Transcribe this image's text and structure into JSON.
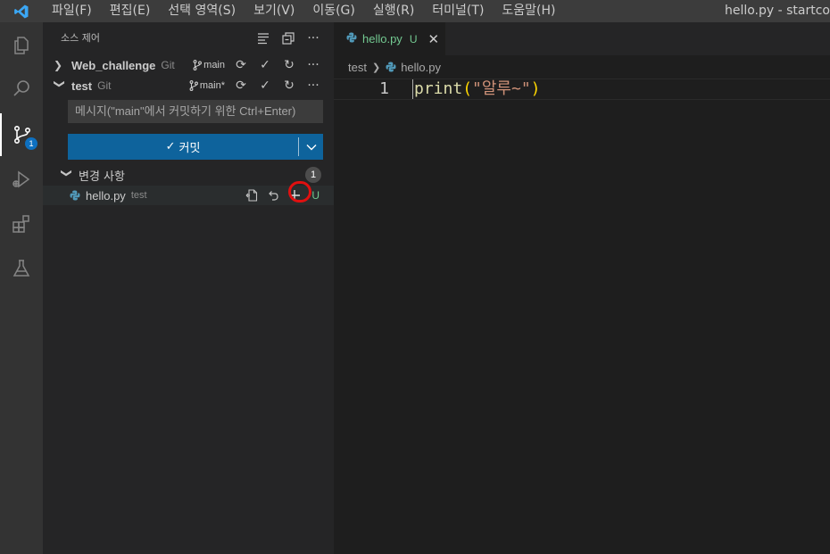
{
  "titlebar": {
    "menu": [
      "파일(F)",
      "편집(E)",
      "선택 영역(S)",
      "보기(V)",
      "이동(G)",
      "실행(R)",
      "터미널(T)",
      "도움말(H)"
    ],
    "window_title": "hello.py - startco"
  },
  "activity": {
    "items": [
      "explorer-icon",
      "search-icon",
      "source-control-icon",
      "run-debug-icon",
      "extensions-icon",
      "testing-icon"
    ],
    "source_control_badge": "1"
  },
  "sidebar": {
    "title": "소스 제어",
    "repos": [
      {
        "name": "Web_challenge",
        "provider": "Git",
        "branch": "main"
      },
      {
        "name": "test",
        "provider": "Git",
        "branch": "main*"
      }
    ],
    "commit_placeholder": "메시지(\"main\"에서 커밋하기 위한 Ctrl+Enter)",
    "commit_label": "커밋",
    "changes": {
      "label": "변경 사항",
      "count": "1",
      "files": [
        {
          "name": "hello.py",
          "dir": "test",
          "status": "U"
        }
      ]
    }
  },
  "editor": {
    "tab": {
      "name": "hello.py",
      "status": "U",
      "close": "✕"
    },
    "breadcrumb": [
      "test",
      "hello.py"
    ],
    "lines": [
      {
        "number": "1",
        "fn": "print",
        "open": "(",
        "str": "\"알루~\"",
        "close": ")"
      }
    ]
  },
  "colors": {
    "accent": "#0e639c",
    "badge": "#0e70c0",
    "untracked": "#73c991",
    "highlight_ring": "#e01010"
  }
}
